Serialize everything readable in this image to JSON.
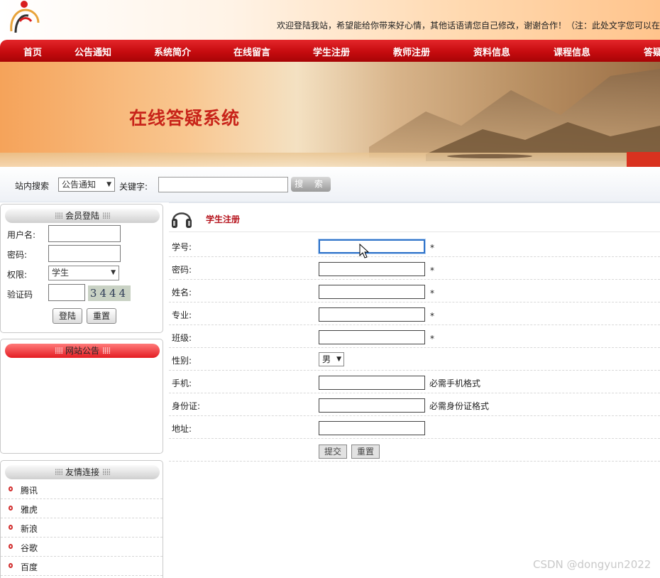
{
  "header": {
    "welcome": "欢迎登陆我站，希望能给你带来好心情，其他话语请您自己修改，谢谢合作！（注：此处文字您可以在"
  },
  "nav": [
    "首页",
    "公告通知",
    "系统简介",
    "在线留言",
    "学生注册",
    "教师注册",
    "资料信息",
    "课程信息",
    "答疑"
  ],
  "banner": {
    "title": "在线答疑系统"
  },
  "search": {
    "label": "站内搜索",
    "category": "公告通知",
    "keyword_label": "关键字:",
    "keyword_value": "",
    "button": "搜 索"
  },
  "login": {
    "title": "会员登陆",
    "username_label": "用户名:",
    "password_label": "密码:",
    "role_label": "权限:",
    "role_value": "学生",
    "captcha_label": "验证码",
    "captcha_text": "3444",
    "login_button": "登陆",
    "reset_button": "重置"
  },
  "notice": {
    "title": "网站公告"
  },
  "links": {
    "title": "友情连接",
    "items": [
      "腾讯",
      "雅虎",
      "新浪",
      "谷歌",
      "百度"
    ]
  },
  "form": {
    "title": "学生注册",
    "required_mark": "*",
    "fields": [
      {
        "label": "学号:",
        "value": ""
      },
      {
        "label": "密码:",
        "value": ""
      },
      {
        "label": "姓名:",
        "value": ""
      },
      {
        "label": "专业:",
        "value": ""
      },
      {
        "label": "班级:",
        "value": ""
      },
      {
        "label": "性别:",
        "value": "男"
      },
      {
        "label": "手机:",
        "value": "",
        "hint": "必需手机格式"
      },
      {
        "label": "身份证:",
        "value": "",
        "hint": "必需身份证格式"
      },
      {
        "label": "地址:",
        "value": ""
      }
    ],
    "submit_button": "提交",
    "reset_button": "重置"
  },
  "watermark": "CSDN @dongyun2022",
  "colors": {
    "nav_red": "#c60b0f",
    "title_red": "#b5121b",
    "banner_title": "#c8241a",
    "focus_blue": "#2f73c9"
  }
}
